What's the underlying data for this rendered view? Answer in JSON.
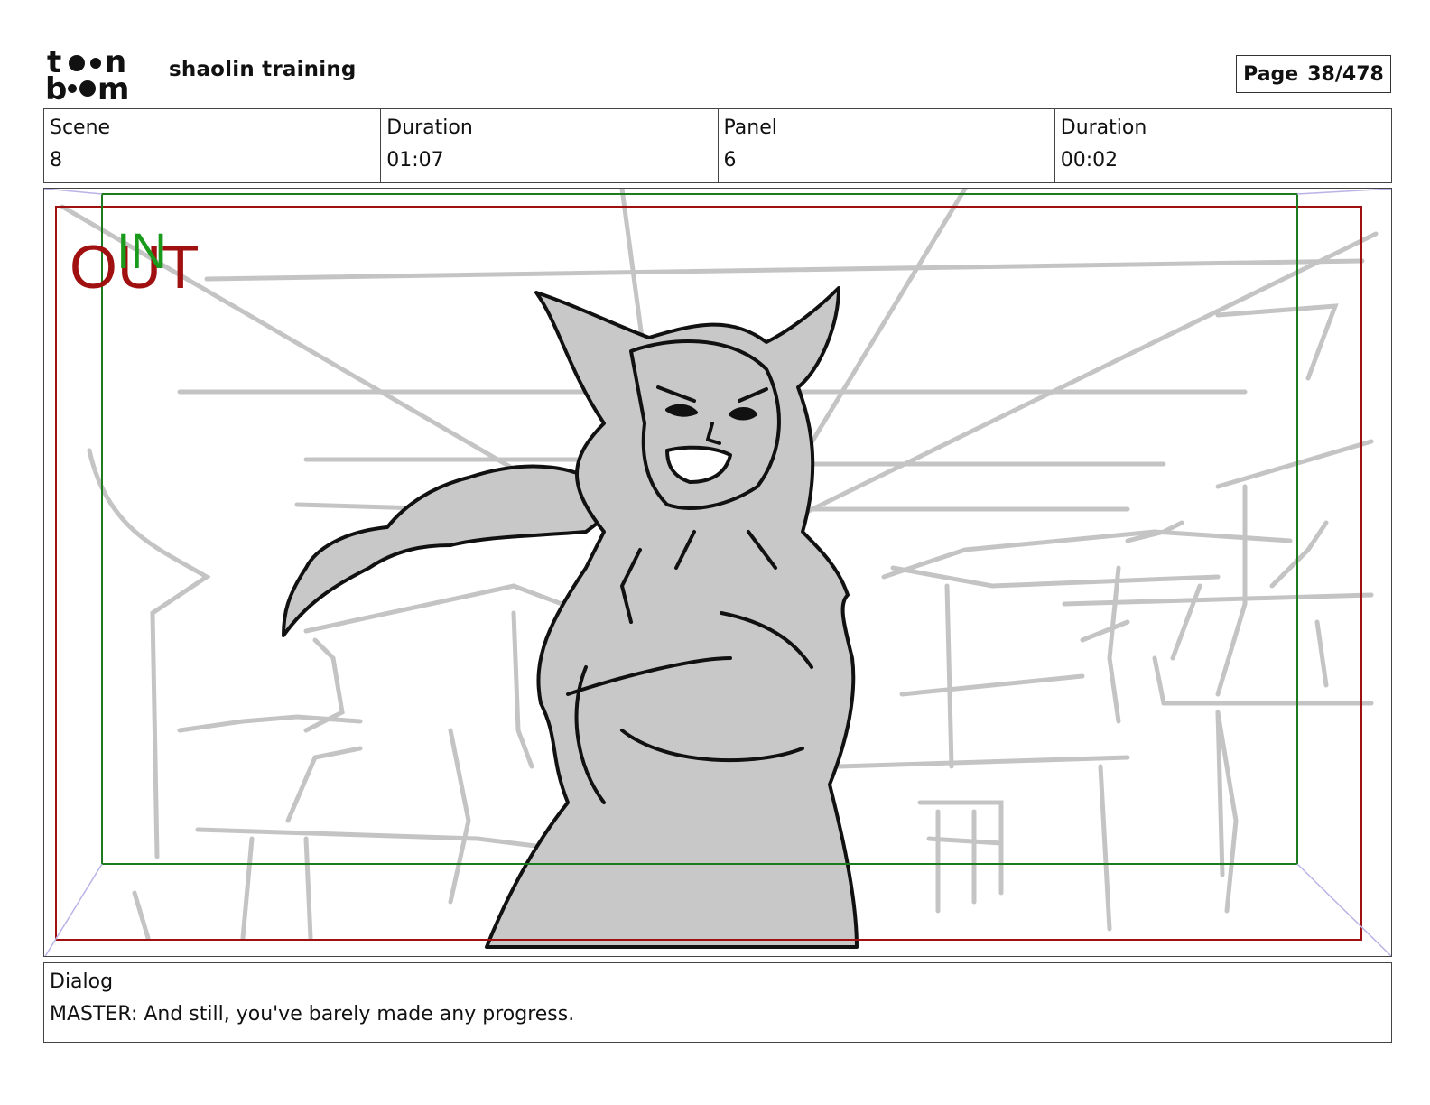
{
  "header": {
    "logo_text": "toon boom",
    "project_title": "shaolin training",
    "page_label": "Page",
    "page_number": "38/478"
  },
  "info": {
    "scene_label": "Scene",
    "scene_value": "8",
    "scene_duration_label": "Duration",
    "scene_duration_value": "01:07",
    "panel_label": "Panel",
    "panel_value": "6",
    "panel_duration_label": "Duration",
    "panel_duration_value": "00:02"
  },
  "frame": {
    "in_label": "IN",
    "out_label": "OUT",
    "in_color": "#1a9a1a",
    "out_color": "#a01010",
    "title_safe_color": "#1e7a1e",
    "action_safe_color": "#a01010"
  },
  "dialog": {
    "label": "Dialog",
    "text": "MASTER: And still, you've barely made any progress."
  }
}
